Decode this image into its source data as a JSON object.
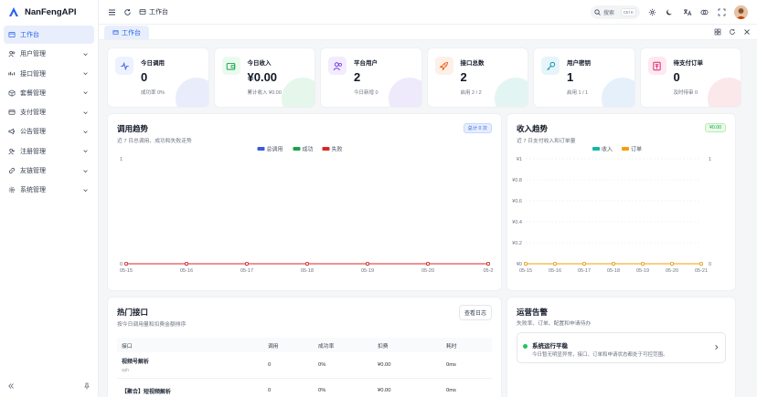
{
  "brand": {
    "name": "NanFengAPI"
  },
  "sidebar": {
    "items": [
      {
        "label": "工作台",
        "icon": "dashboard-icon",
        "active": true,
        "has_children": false
      },
      {
        "label": "用户管理",
        "icon": "users-icon",
        "has_children": true
      },
      {
        "label": "接口管理",
        "icon": "api-icon",
        "has_children": true
      },
      {
        "label": "套餐管理",
        "icon": "package-icon",
        "has_children": true
      },
      {
        "label": "支付管理",
        "icon": "payment-icon",
        "has_children": true
      },
      {
        "label": "公告管理",
        "icon": "announcement-icon",
        "has_children": true
      },
      {
        "label": "注册管理",
        "icon": "register-icon",
        "has_children": true
      },
      {
        "label": "友链管理",
        "icon": "link-icon",
        "has_children": true
      },
      {
        "label": "系统管理",
        "icon": "settings-icon",
        "has_children": true
      }
    ]
  },
  "topbar": {
    "breadcrumb": "工作台",
    "search_placeholder": "搜索",
    "search_shortcut": "Ctrl K"
  },
  "tabs": [
    {
      "label": "工作台",
      "active": true
    }
  ],
  "stats": [
    {
      "title": "今日调用",
      "value": "0",
      "sub": "成功率 0%",
      "icon": "activity-icon",
      "color": "#4f6bed",
      "bg": "#eef2fe",
      "blob": "#e9edfb"
    },
    {
      "title": "今日收入",
      "value": "¥0.00",
      "sub": "累计收入 ¥0.00",
      "icon": "wallet-icon",
      "color": "#16a34a",
      "bg": "#eafaef",
      "blob": "#e4f7ea"
    },
    {
      "title": "平台用户",
      "value": "2",
      "sub": "今日新增 0",
      "icon": "users-icon",
      "color": "#7c3aed",
      "bg": "#f1ecfe",
      "blob": "#efe9fc"
    },
    {
      "title": "接口总数",
      "value": "2",
      "sub": "启用 2 / 2",
      "icon": "rocket-icon",
      "color": "#ea580c",
      "bg": "#fdf0e8",
      "blob": "#e3f5f2"
    },
    {
      "title": "用户密钥",
      "value": "1",
      "sub": "启用 1 / 1",
      "icon": "key-icon",
      "color": "#0891b2",
      "bg": "#e7f5fa",
      "blob": "#e6f0fb"
    },
    {
      "title": "待支付订单",
      "value": "0",
      "sub": "及时待审 0",
      "icon": "order-icon",
      "color": "#db2777",
      "bg": "#fde9ef",
      "blob": "#fbe8ea"
    }
  ],
  "usage_card": {
    "title": "调用趋势",
    "subtitle": "近 7 日总调用、成功和失败走势",
    "badge": "总计 0 次"
  },
  "income_card": {
    "title": "收入趋势",
    "subtitle": "近 7 日支付收入和订单量",
    "badge": "¥0.00"
  },
  "hot_card": {
    "title": "热门接口",
    "subtitle": "按今日调用量和扣费金额排序",
    "button": "查看日志",
    "columns": [
      "接口",
      "调用",
      "成功率",
      "扣费",
      "耗时"
    ],
    "rows": [
      {
        "name": "视频号解析",
        "sub": "sph",
        "calls": "0",
        "rate": "0%",
        "fee": "¥0.00",
        "time": "0ms"
      },
      {
        "name": "【聚合】短视频解析",
        "sub": "",
        "calls": "0",
        "rate": "0%",
        "fee": "¥0.00",
        "time": "0ms"
      }
    ]
  },
  "alert_card": {
    "title": "运营告警",
    "subtitle": "失败率、订单、配置和申请待办",
    "item_title": "系统运行平稳",
    "item_desc": "今日暂无明显异常，接口、订单和申请状态都处于可控范围。"
  },
  "chart_data": [
    {
      "type": "line",
      "title": "调用趋势",
      "categories": [
        "05-15",
        "05-16",
        "05-17",
        "05-18",
        "05-19",
        "05-20",
        "05-2"
      ],
      "ylim": [
        0,
        1
      ],
      "yticks": [
        "0",
        "1"
      ],
      "legend_position": "top-center",
      "series": [
        {
          "name": "总调用",
          "color": "#3b5bdb",
          "values": [
            0,
            0,
            0,
            0,
            0,
            0,
            0
          ]
        },
        {
          "name": "成功",
          "color": "#16a34a",
          "values": [
            0,
            0,
            0,
            0,
            0,
            0,
            0
          ]
        },
        {
          "name": "失败",
          "color": "#dc2626",
          "values": [
            0,
            0,
            0,
            0,
            0,
            0,
            0
          ]
        }
      ]
    },
    {
      "type": "line",
      "title": "收入趋势",
      "categories": [
        "05-15",
        "05-16",
        "05-17",
        "05-18",
        "05-19",
        "05-20",
        "05-21"
      ],
      "ylim": [
        0,
        1
      ],
      "yticks": [
        "¥0",
        "¥0.2",
        "¥0.4",
        "¥0.6",
        "¥0.8",
        "¥1"
      ],
      "y2ticks": [
        "0",
        "1"
      ],
      "legend_position": "top-center",
      "series": [
        {
          "name": "收入",
          "color": "#14b8a6",
          "values": [
            0,
            0,
            0,
            0,
            0,
            0,
            0
          ]
        },
        {
          "name": "订单",
          "color": "#f59e0b",
          "values": [
            0,
            0,
            0,
            0,
            0,
            0,
            0
          ]
        }
      ]
    }
  ]
}
